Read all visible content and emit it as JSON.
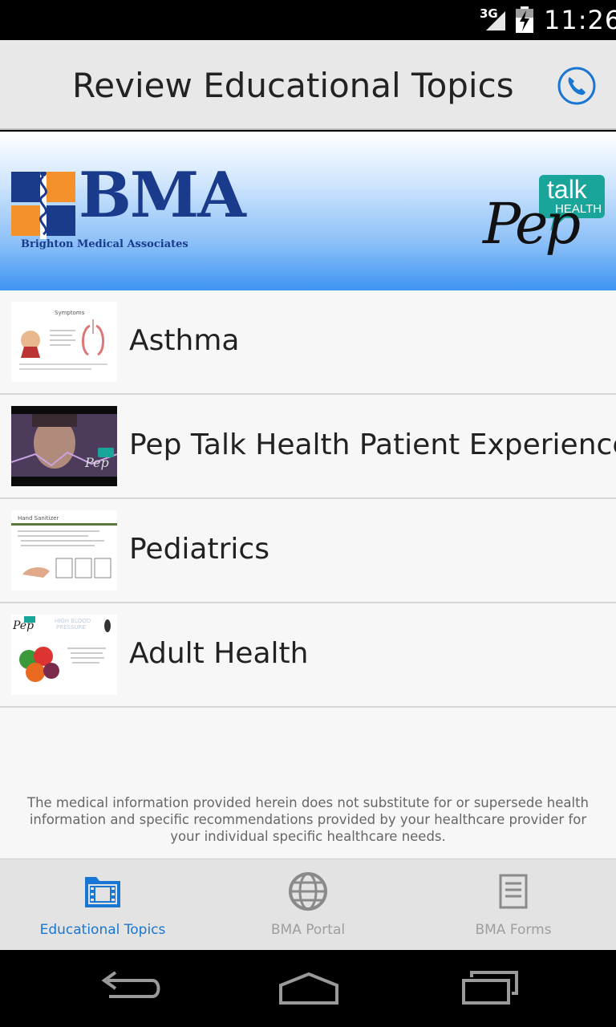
{
  "status_bar": {
    "network": "3G",
    "time": "11:26"
  },
  "header": {
    "title": "Review Educational Topics",
    "phone_icon": "phone-icon"
  },
  "banner": {
    "bma_logo_text": "BMA",
    "bma_subtitle": "Brighton Medical Associates",
    "pep_logo_text": "Pep",
    "pep_talk_text": "talk",
    "pep_health_text": "HEALTH"
  },
  "topics": [
    {
      "label": "Asthma",
      "thumb": "asthma-symptoms-thumbnail"
    },
    {
      "label": "Pep Talk Health Patient Experience",
      "thumb": "patient-video-thumbnail"
    },
    {
      "label": "Pediatrics",
      "thumb": "hand-sanitizer-thumbnail"
    },
    {
      "label": "Adult Health",
      "thumb": "blood-pressure-thumbnail"
    }
  ],
  "disclaimer": "The medical information provided herein does not substitute for or supersede health information and specific recommendations provided by your healthcare provider for your individual specific healthcare needs.",
  "tabs": [
    {
      "label": "Educational Topics",
      "icon": "film-folder-icon",
      "active": true
    },
    {
      "label": "BMA Portal",
      "icon": "globe-icon",
      "active": false
    },
    {
      "label": "BMA Forms",
      "icon": "document-icon",
      "active": false
    }
  ],
  "colors": {
    "accent": "#1976d2",
    "bma_navy": "#1a3a8c",
    "pep_teal": "#1aa59a",
    "banner_blue": "#3d94f2"
  }
}
